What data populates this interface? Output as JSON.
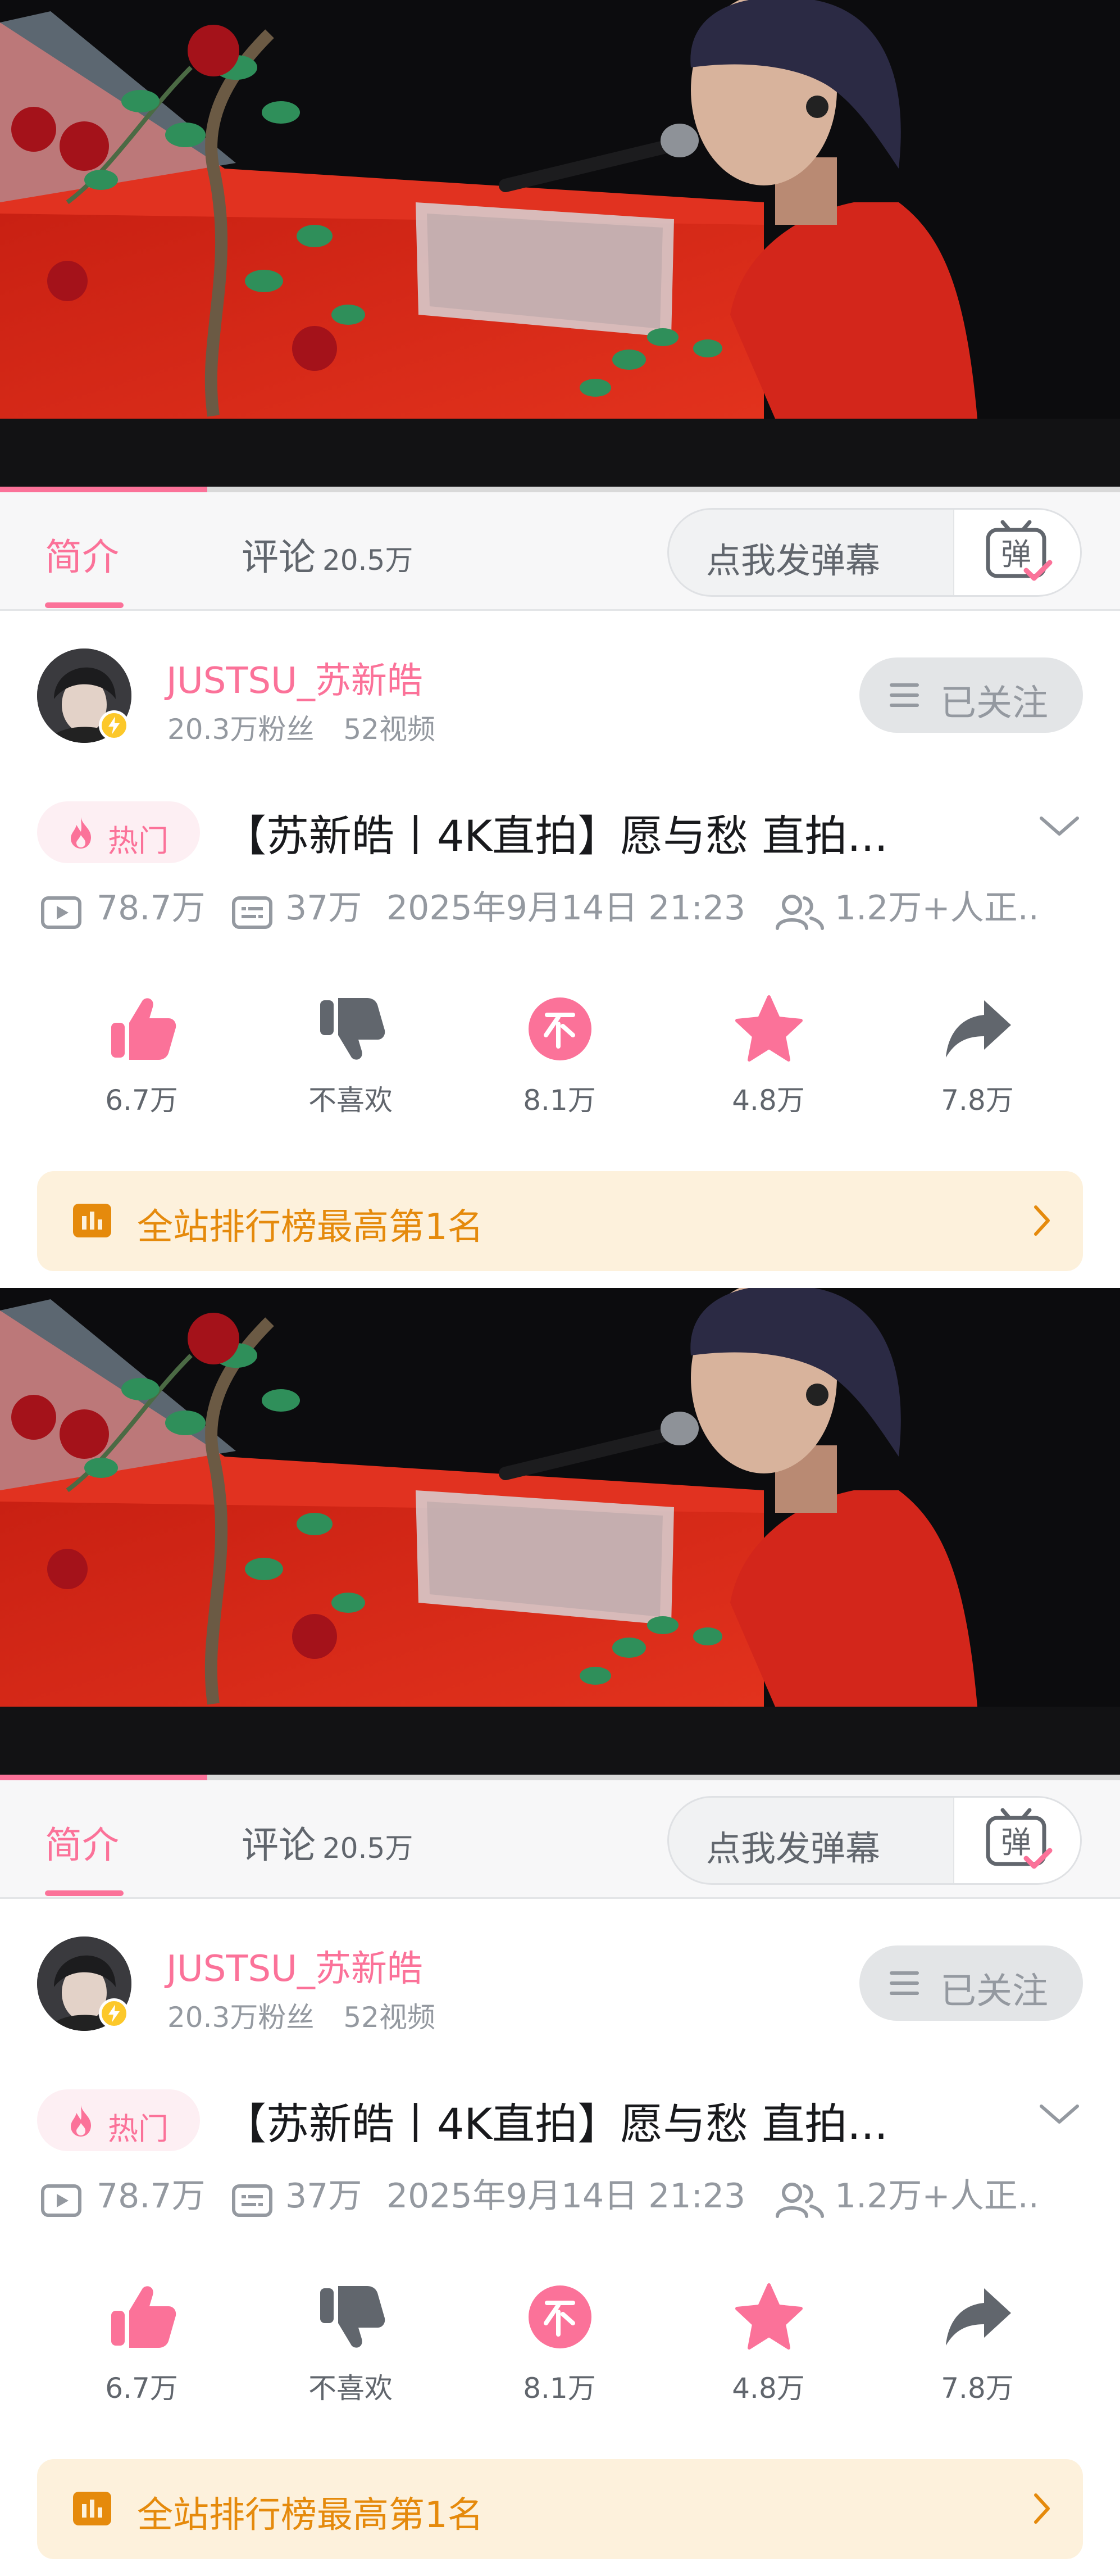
{
  "tabs": {
    "intro_label": "简介",
    "comments_label": "评论",
    "comments_count": "20.5万",
    "danmaku_placeholder": "点我发弹幕",
    "danmaku_button_glyph": "弹"
  },
  "author": {
    "name": "JUSTSU_苏新皓",
    "followers": "20.3万粉丝",
    "videos": "52视频",
    "follow_label": "已关注"
  },
  "video": {
    "hot_label": "热门",
    "title": "【苏新皓丨4K直拍】愿与愁 直拍...",
    "views": "78.7万",
    "danmaku_count": "37万",
    "date": "2025年9月14日 21:23",
    "watching": "1.2万+人正..",
    "progress_fraction": 0.185
  },
  "actions": {
    "like": "6.7万",
    "dislike": "不喜欢",
    "coin": "8.1万",
    "favorite": "4.8万",
    "share": "7.8万"
  },
  "ranking": {
    "label": "全站排行榜最高第1名"
  },
  "colors": {
    "accent": "#fb7299",
    "ranking": "#e58a0c",
    "ranking_bg": "#fdf1dc",
    "muted": "#9499a0",
    "icon_dark": "#61666d"
  }
}
